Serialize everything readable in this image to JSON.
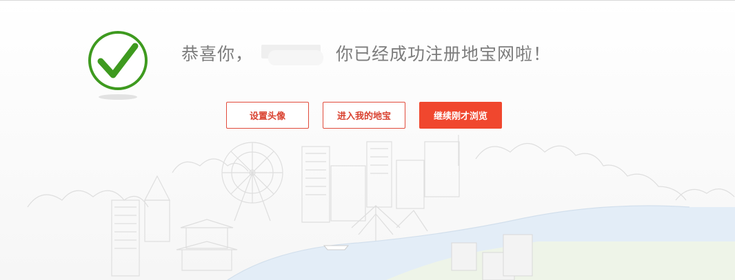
{
  "message": {
    "prefix": "恭喜你，",
    "username": "",
    "suffix": "你已经成功注册地宝网啦！"
  },
  "actions": {
    "set_avatar": "设置头像",
    "enter_my_dibao": "进入我的地宝",
    "continue_browsing": "继续刚才浏览"
  },
  "colors": {
    "success_green": "#3e9a1f",
    "accent_red": "#f0472e",
    "text_gray": "#7c7c7c"
  },
  "icons": {
    "success": "check-circle-icon"
  }
}
